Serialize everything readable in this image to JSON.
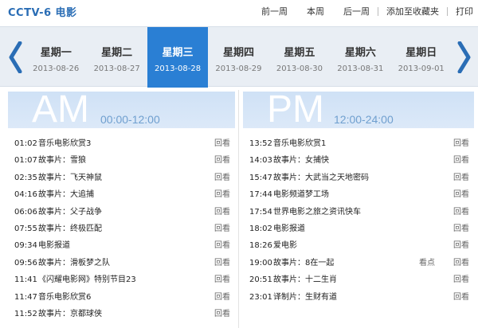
{
  "header": {
    "channel": "CCTV-6 电影",
    "links": [
      "前一周",
      "本周",
      "后一周",
      "添加至收藏夹",
      "打印"
    ]
  },
  "week": {
    "prev_icon": "chevron-left-icon",
    "next_icon": "chevron-right-icon",
    "days": [
      {
        "name": "星期一",
        "date": "2013-08-26"
      },
      {
        "name": "星期二",
        "date": "2013-08-27"
      },
      {
        "name": "星期三",
        "date": "2013-08-28"
      },
      {
        "name": "星期四",
        "date": "2013-08-29"
      },
      {
        "name": "星期五",
        "date": "2013-08-30"
      },
      {
        "name": "星期六",
        "date": "2013-08-31"
      },
      {
        "name": "星期日",
        "date": "2013-09-01"
      }
    ],
    "active_index": 2
  },
  "am": {
    "label": "AM",
    "range": "00:00-12:00",
    "items": [
      {
        "time": "01:02",
        "title": "音乐电影欣赏3",
        "action": "回看"
      },
      {
        "time": "01:07",
        "title": "故事片：雪狼",
        "action": "回看"
      },
      {
        "time": "02:35",
        "title": "故事片：飞天神鼠",
        "action": "回看"
      },
      {
        "time": "04:16",
        "title": "故事片：大追捕",
        "action": "回看"
      },
      {
        "time": "06:06",
        "title": "故事片：父子战争",
        "action": "回看"
      },
      {
        "time": "07:55",
        "title": "故事片：终极匹配",
        "action": "回看"
      },
      {
        "time": "09:34",
        "title": "电影报道",
        "action": "回看"
      },
      {
        "time": "09:56",
        "title": "故事片：滑板梦之队",
        "action": "回看"
      },
      {
        "time": "11:41",
        "title": "《闪耀电影网》特别节目23",
        "action": "回看"
      },
      {
        "time": "11:47",
        "title": "音乐电影欣赏6",
        "action": "回看"
      },
      {
        "time": "11:52",
        "title": "故事片：京都球侠",
        "action": "回看"
      }
    ]
  },
  "pm": {
    "label": "PM",
    "range": "12:00-24:00",
    "items": [
      {
        "time": "13:52",
        "title": "音乐电影欣赏1",
        "action": "回看"
      },
      {
        "time": "14:03",
        "title": "故事片：女捕快",
        "action": "回看"
      },
      {
        "time": "15:47",
        "title": "故事片：大武当之天地密码",
        "action": "回看"
      },
      {
        "time": "17:44",
        "title": "电影频道梦工场",
        "action": "回看"
      },
      {
        "time": "17:54",
        "title": "世界电影之旅之资讯快车",
        "action": "回看"
      },
      {
        "time": "18:02",
        "title": "电影报道",
        "action": "回看"
      },
      {
        "time": "18:26",
        "title": "爱电影",
        "action": "回看"
      },
      {
        "time": "19:00",
        "title": "故事片：8在一起",
        "extra": "看点",
        "action": "回看"
      },
      {
        "time": "20:51",
        "title": "故事片：十二生肖",
        "action": "回看"
      },
      {
        "time": "23:01",
        "title": "译制片：生财有道",
        "action": "回看"
      }
    ]
  },
  "colors": {
    "brand": "#2a6db5",
    "active_day": "#2a7fd4",
    "arrow": "#2a6db5"
  }
}
